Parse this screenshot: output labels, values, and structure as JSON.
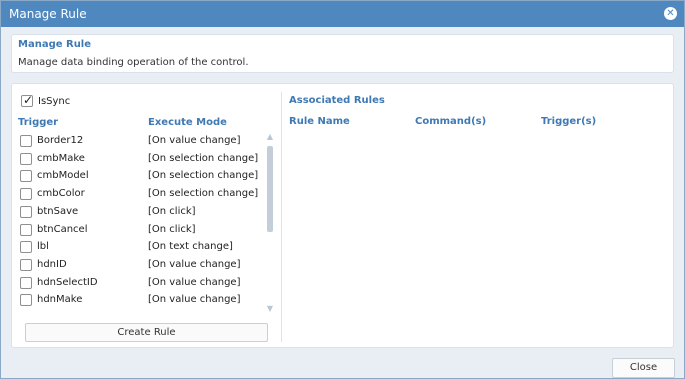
{
  "window": {
    "title": "Manage Rule",
    "close_icon": "close-icon"
  },
  "header": {
    "title": "Manage Rule",
    "description": "Manage data binding operation of the control."
  },
  "issync": {
    "label": "IsSync",
    "checked": true
  },
  "triggers": {
    "col_trigger": "Trigger",
    "col_mode": "Execute Mode",
    "rows": [
      {
        "trigger": "Border12",
        "mode": "[On value change]",
        "checked": false
      },
      {
        "trigger": "cmbMake",
        "mode": "[On selection change]",
        "checked": false
      },
      {
        "trigger": "cmbModel",
        "mode": "[On selection change]",
        "checked": false
      },
      {
        "trigger": "cmbColor",
        "mode": "[On selection change]",
        "checked": false
      },
      {
        "trigger": "btnSave",
        "mode": "[On click]",
        "checked": false
      },
      {
        "trigger": "btnCancel",
        "mode": "[On click]",
        "checked": false
      },
      {
        "trigger": "lbl",
        "mode": "[On text change]",
        "checked": false
      },
      {
        "trigger": "hdnID",
        "mode": "[On value change]",
        "checked": false
      },
      {
        "trigger": "hdnSelectID",
        "mode": "[On value change]",
        "checked": false
      },
      {
        "trigger": "hdnMake",
        "mode": "[On value change]",
        "checked": false
      }
    ],
    "create_label": "Create Rule"
  },
  "associated": {
    "title": "Associated Rules",
    "col_rule": "Rule Name",
    "col_commands": "Command(s)",
    "col_trigger": "Trigger(s)"
  },
  "footer": {
    "close_label": "Close"
  }
}
